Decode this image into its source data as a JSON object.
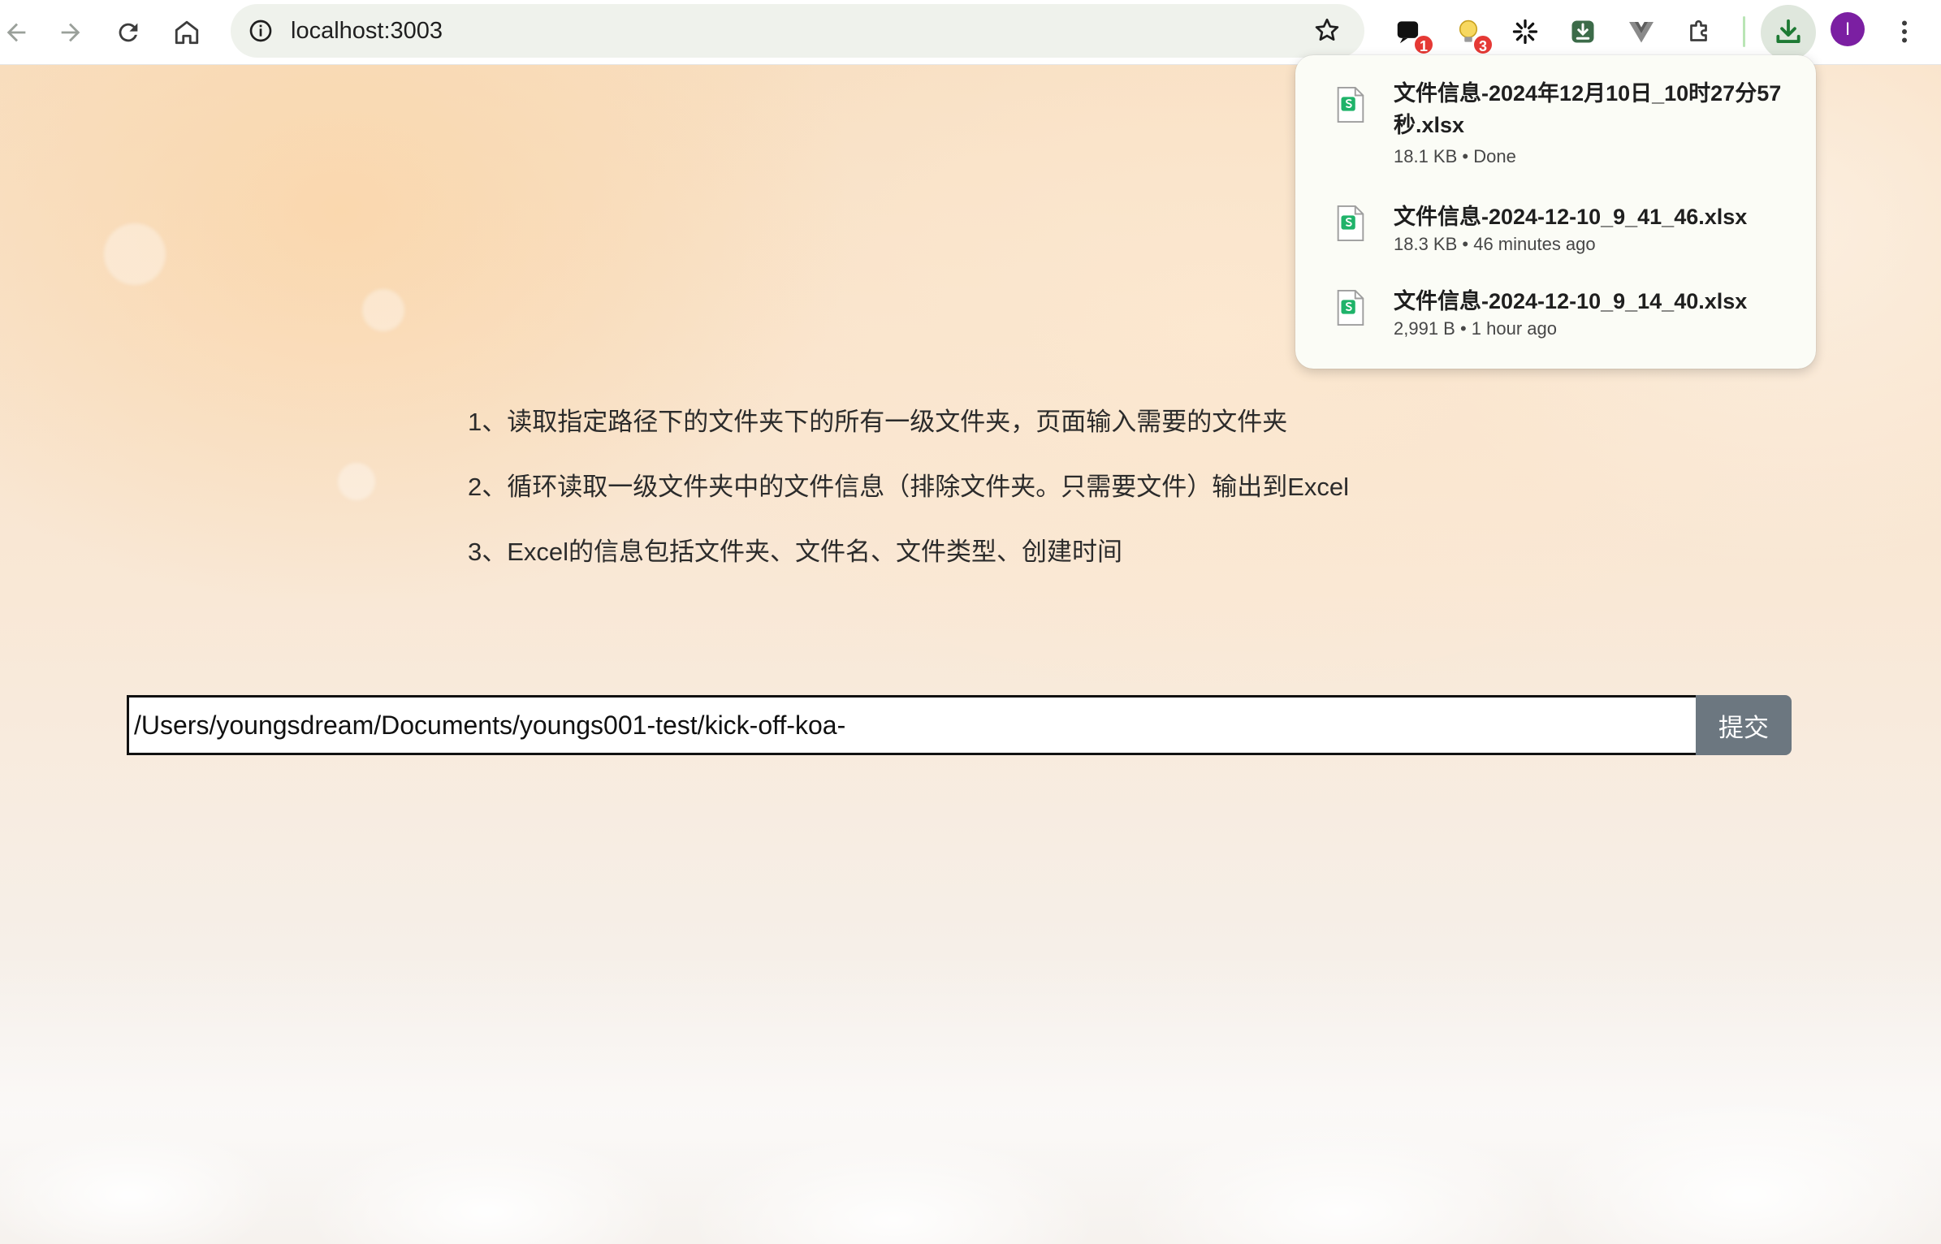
{
  "browser": {
    "url": "localhost:3003",
    "extensions": [
      {
        "name": "ext-chat",
        "badge": "1"
      },
      {
        "name": "ext-bulb",
        "badge": "3"
      },
      {
        "name": "ext-spinner",
        "badge": ""
      },
      {
        "name": "ext-downloader",
        "badge": ""
      },
      {
        "name": "ext-vue",
        "badge": ""
      },
      {
        "name": "ext-puzzle",
        "badge": ""
      }
    ],
    "profile_initial": "I",
    "colors": {
      "download_accent": "#1e7a34",
      "avatar": "#7b1fa2",
      "badge": "#e53935"
    }
  },
  "downloads": [
    {
      "name_line1": "文件信息-2024年12月10日_10时27分57",
      "name_line2": "秒.xlsx",
      "meta": "18.1 KB • Done"
    },
    {
      "name_line1": "文件信息-2024-12-10_9_41_46.xlsx",
      "name_line2": "",
      "meta": "18.3 KB • 46 minutes ago"
    },
    {
      "name_line1": "文件信息-2024-12-10_9_14_40.xlsx",
      "name_line2": "",
      "meta": "2,991 B • 1 hour ago"
    }
  ],
  "content": {
    "instructions": [
      "1、读取指定路径下的文件夹下的所有一级文件夹，页面输入需要的文件夹",
      "2、循环读取一级文件夹中的文件信息（排除文件夹。只需要文件）输出到Excel",
      "3、Excel的信息包括文件夹、文件名、文件类型、创建时间"
    ],
    "path_value": "/Users/youngsdream/Documents/youngs001-test/kick-off-koa-",
    "submit_label": "提交"
  }
}
